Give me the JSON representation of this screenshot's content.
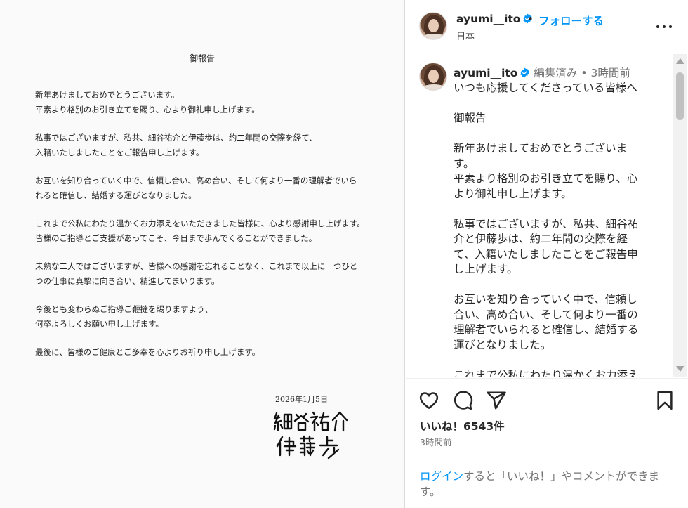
{
  "letter": {
    "title": "御報告",
    "paragraphs": [
      [
        "新年あけましておめでとうございます。",
        "平素より格別のお引き立てを賜り、心より御礼申し上げます。"
      ],
      [
        "私事ではございますが、私共、細谷祐介と伊藤歩は、約二年間の交際を経て、",
        "入籍いたしましたことをご報告申し上げます。"
      ],
      [
        "お互いを知り合っていく中で、信頼し合い、高め合い、そして何より一番の理解者でいら",
        "れると確信し、結婚する運びとなりました。"
      ],
      [
        "これまで公私にわたり温かくお力添えをいただきました皆様に、心より感謝申し上げます。",
        "皆様のご指導とご支援があってこそ、今日まで歩んでくることができました。"
      ],
      [
        "未熟な二人ではございますが、皆様への感謝を忘れることなく、これまで以上に一つひと",
        "つの仕事に真摯に向き合い、精進してまいります。"
      ],
      [
        "今後とも変わらぬご指導ご鞭撻を賜りますよう、",
        "何卒よろしくお願い申し上げます。"
      ],
      [
        "最後に、皆様のご健康とご多幸を心よりお祈り申し上げます。"
      ]
    ],
    "date": "2026年1月5日",
    "signature_names": [
      "細谷祐介",
      "伊藤歩"
    ]
  },
  "header": {
    "username": "ayumi__ito",
    "separator": "•",
    "follow_label": "フォローする",
    "location": "日本",
    "more_icon": "more-horizontal-icon"
  },
  "caption": {
    "username": "ayumi__ito",
    "edited": "編集済み",
    "separator": "•",
    "time": "3時間前",
    "lines": [
      "いつも応援してくださっている皆様へ",
      "",
      "御報告",
      "",
      "新年あけましておめでとうございま",
      "す。",
      "平素より格別のお引き立てを賜り、心",
      "より御礼申し上げます。",
      "",
      "私事ではございますが、私共、細谷祐",
      "介と伊藤歩は、約二年間の交際を経",
      "て、入籍いたしましたことをご報告申",
      "し上げます。",
      "",
      "お互いを知り合っていく中で、信頼し",
      "合い、高め合い、そして何より一番の",
      "理解者でいられると確信し、結婚する",
      "運びとなりました。",
      "",
      "これまで公私にわたり温かくお力添え"
    ]
  },
  "actions": {
    "icons": [
      "heart-icon",
      "comment-icon",
      "share-icon",
      "bookmark-icon"
    ],
    "likes": "いいね！6543件",
    "time": "3時間前",
    "login_link": "ログイン",
    "login_text": "すると「いいね！」やコメントができます。"
  },
  "colors": {
    "accent": "#0095f6",
    "verified": "#0095f6",
    "muted": "#737373",
    "text": "#262626"
  }
}
